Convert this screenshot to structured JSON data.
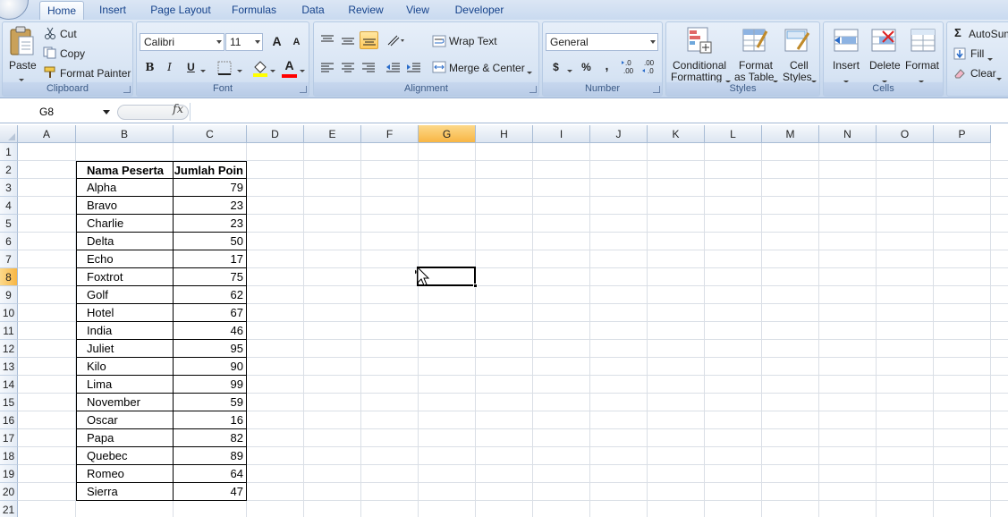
{
  "tabs": [
    "Home",
    "Insert",
    "Page Layout",
    "Formulas",
    "Data",
    "Review",
    "View",
    "Developer"
  ],
  "clipboard": {
    "paste": "Paste",
    "cut": "Cut",
    "copy": "Copy",
    "format_painter": "Format Painter",
    "label": "Clipboard"
  },
  "font": {
    "name": "Calibri",
    "size": "11",
    "grow": "A",
    "shrink": "A",
    "bold": "B",
    "italic": "I",
    "underline": "U",
    "color_a": "A",
    "label": "Font"
  },
  "alignment": {
    "wrap_text": "Wrap Text",
    "merge_center": "Merge & Center",
    "label": "Alignment"
  },
  "number": {
    "format": "General",
    "currency": "$",
    "percent": "%",
    "comma": ",",
    "inc_decimal": ".0\n.00",
    "dec_decimal": ".00\n.0",
    "label": "Number"
  },
  "styles": {
    "conditional": "Conditional",
    "conditional2": "Formatting",
    "format_table": "Format",
    "format_table2": "as Table",
    "cell_styles": "Cell",
    "cell_styles2": "Styles",
    "label": "Styles"
  },
  "cells": {
    "insert": "Insert",
    "delete": "Delete",
    "format": "Format",
    "label": "Cells"
  },
  "editing": {
    "autosum": "AutoSum",
    "fill": "Fill",
    "clear": "Clear"
  },
  "formula_bar": {
    "name_box": "G8",
    "fx": "fx",
    "value": ""
  },
  "columns": [
    "A",
    "B",
    "C",
    "D",
    "E",
    "F",
    "G",
    "H",
    "I",
    "J",
    "K",
    "L",
    "M",
    "N",
    "O",
    "P"
  ],
  "rows": [
    "1",
    "2",
    "3",
    "4",
    "5",
    "6",
    "7",
    "8",
    "9",
    "10",
    "11",
    "12",
    "13",
    "14",
    "15",
    "16",
    "17",
    "18",
    "19",
    "20",
    "21"
  ],
  "selected": {
    "column": "G",
    "row": "8"
  },
  "table": {
    "headers": [
      "Nama Peserta",
      "Jumlah Poin"
    ],
    "rows": [
      [
        "Alpha",
        "79"
      ],
      [
        "Bravo",
        "23"
      ],
      [
        "Charlie",
        "23"
      ],
      [
        "Delta",
        "50"
      ],
      [
        "Echo",
        "17"
      ],
      [
        "Foxtrot",
        "75"
      ],
      [
        "Golf",
        "62"
      ],
      [
        "Hotel",
        "67"
      ],
      [
        "India",
        "46"
      ],
      [
        "Juliet",
        "95"
      ],
      [
        "Kilo",
        "90"
      ],
      [
        "Lima",
        "99"
      ],
      [
        "November",
        "59"
      ],
      [
        "Oscar",
        "16"
      ],
      [
        "Papa",
        "82"
      ],
      [
        "Quebec",
        "89"
      ],
      [
        "Romeo",
        "64"
      ],
      [
        "Sierra",
        "47"
      ]
    ]
  },
  "colors": {
    "selection_header": "#f8b644",
    "ribbon": "#d2e0f1",
    "tab_text": "#15428b"
  }
}
